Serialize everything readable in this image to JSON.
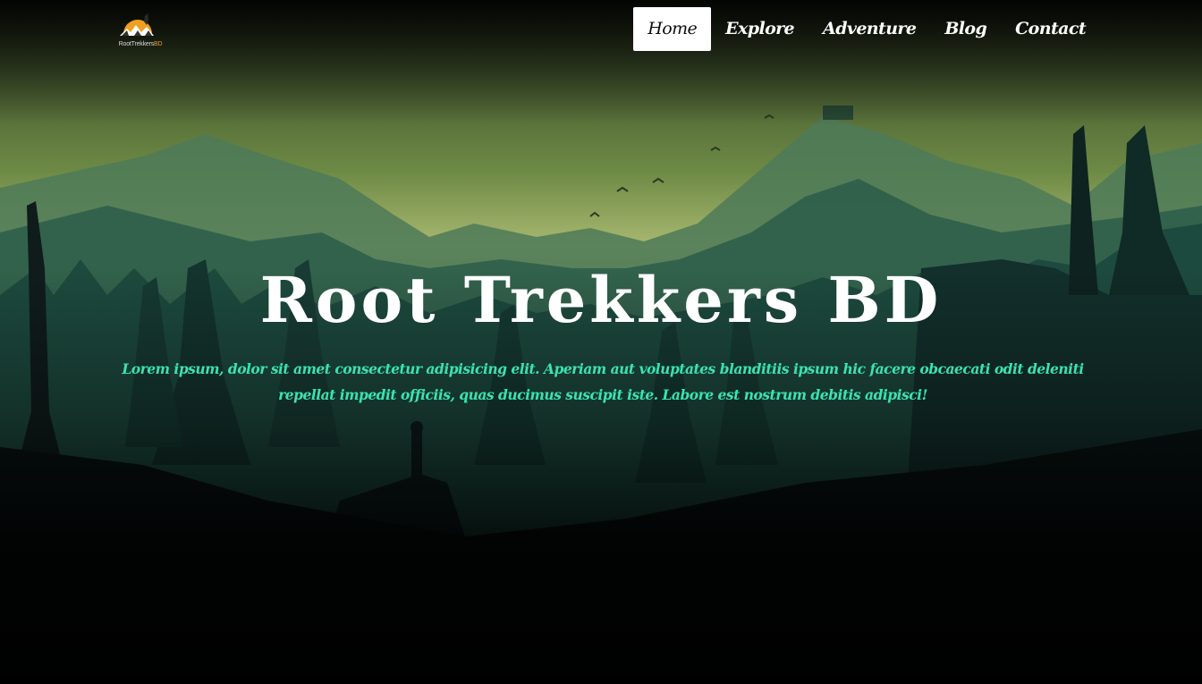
{
  "brand": {
    "logo_text": "RootTrekkers",
    "logo_text_suffix": "BD"
  },
  "nav": {
    "items": [
      {
        "label": "Home",
        "active": true
      },
      {
        "label": "Explore",
        "active": false
      },
      {
        "label": "Adventure",
        "active": false
      },
      {
        "label": "Blog",
        "active": false
      },
      {
        "label": "Contact",
        "active": false
      }
    ]
  },
  "hero": {
    "title": "Root Trekkers BD",
    "text": "Lorem ipsum, dolor sit amet consectetur adipisicing elit. Aperiam aut voluptates blanditiis ipsum hic facere obcaecati odit deleniti repellat impedit officiis, quas ducimus suscipit iste. Labore est nostrum debitis adipisci!"
  },
  "colors": {
    "accent_text": "#3ae3b0",
    "nav_active_bg": "#ffffff",
    "logo_sun": "#f0a020"
  }
}
